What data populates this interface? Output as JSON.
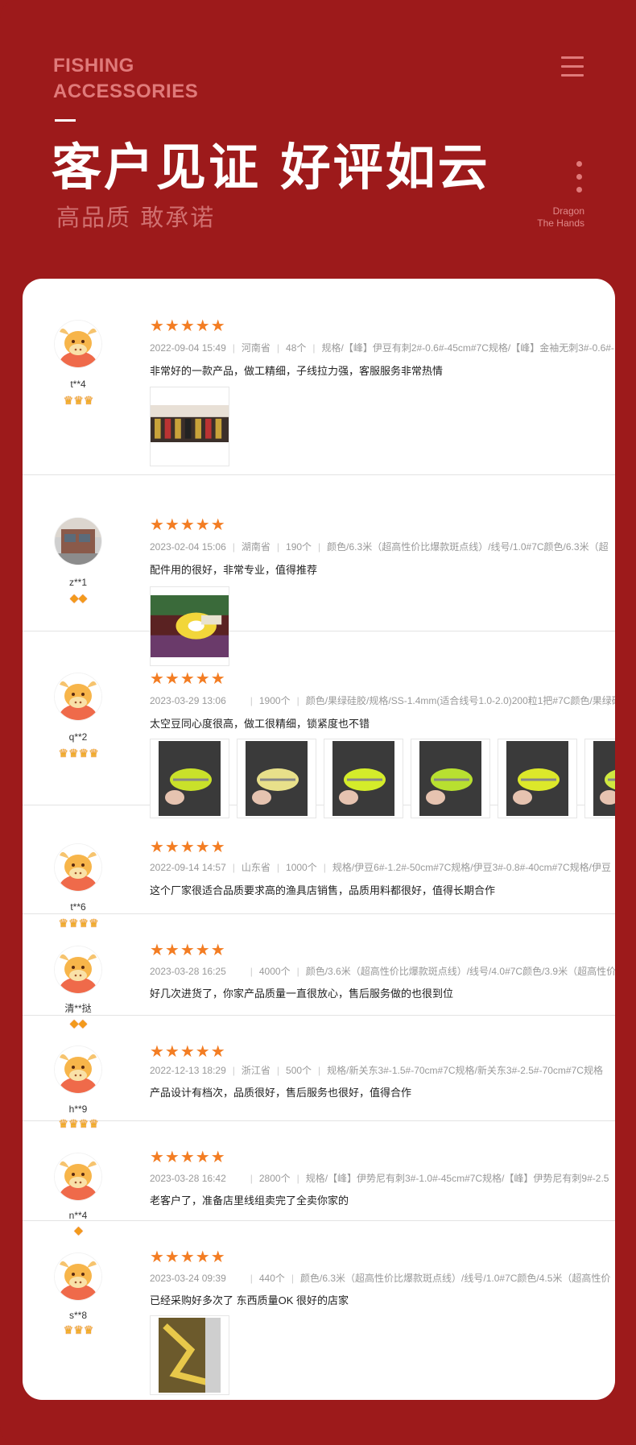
{
  "header": {
    "brand_line1": "FISHING",
    "brand_line2": "ACCESSORIES",
    "headline": "客户见证 好评如云",
    "subline": "高品质 敢承诺",
    "tagline_line1": "Dragon",
    "tagline_line2": "The Hands"
  },
  "colors": {
    "background": "#9d1a1b",
    "accent_star": "#f37d23",
    "card": "#ffffff"
  },
  "reviews": [
    {
      "user": "t**4",
      "badges": [
        "crown",
        "crown",
        "crown"
      ],
      "stars": "★★★★★",
      "date": "2022-09-04 15:49",
      "province": "河南省",
      "qty": "48个",
      "spec": "规格/【峰】伊豆有刺2#-0.6#-45cm#7C规格/【峰】金袖无刺3#-0.6#-",
      "comment": "非常好的一款产品，做工精细，子线拉力强，客服服务非常热情",
      "images": 1
    },
    {
      "user": "z**1",
      "badges": [
        "gem",
        "gem"
      ],
      "stars": "★★★★★",
      "date": "2023-02-04 15:06",
      "province": "湖南省",
      "qty": "190个",
      "spec": "颜色/6.3米（超高性价比爆款斑点线）/线号/1.0#7C颜色/6.3米（超",
      "comment": "配件用的很好，非常专业，值得推荐",
      "images": 1
    },
    {
      "user": "q**2",
      "badges": [
        "crown",
        "crown",
        "crown",
        "crown"
      ],
      "stars": "★★★★★",
      "date": "2023-03-29 13:06",
      "province": "",
      "qty": "1900个",
      "spec": "颜色/果绿硅胶/规格/SS-1.4mm(适合线号1.0-2.0)200粒1把#7C颜色/果绿硅",
      "comment": "太空豆同心度很高，做工很精细，锁紧度也不错",
      "images": 6
    },
    {
      "user": "t**6",
      "badges": [
        "crown",
        "crown",
        "crown",
        "crown"
      ],
      "stars": "★★★★★",
      "date": "2022-09-14 14:57",
      "province": "山东省",
      "qty": "1000个",
      "spec": "规格/伊豆6#-1.2#-50cm#7C规格/伊豆3#-0.8#-40cm#7C规格/伊豆",
      "comment": "这个厂家很适合品质要求高的渔具店销售，品质用料都很好，值得长期合作",
      "images": 0
    },
    {
      "user": "清**挞",
      "badges": [
        "gem",
        "gem"
      ],
      "stars": "★★★★★",
      "date": "2023-03-28 16:25",
      "province": "",
      "qty": "4000个",
      "spec": "颜色/3.6米（超高性价比爆款斑点线）/线号/4.0#7C颜色/3.9米（超高性价",
      "comment": "好几次进货了，你家产品质量一直很放心，售后服务做的也很到位",
      "images": 0
    },
    {
      "user": "h**9",
      "badges": [
        "crown",
        "crown",
        "crown",
        "crown"
      ],
      "stars": "★★★★★",
      "date": "2022-12-13 18:29",
      "province": "浙江省",
      "qty": "500个",
      "spec": "规格/新关东3#-1.5#-70cm#7C规格/新关东3#-2.5#-70cm#7C规格",
      "comment": "产品设计有档次，品质很好，售后服务也很好，值得合作",
      "images": 0
    },
    {
      "user": "n**4",
      "badges": [
        "gem"
      ],
      "stars": "★★★★★",
      "date": "2023-03-28 16:42",
      "province": "",
      "qty": "2800个",
      "spec": "规格/【峰】伊势尼有刺3#-1.0#-45cm#7C规格/【峰】伊势尼有刺9#-2.5",
      "comment": "老客户了，准备店里线组卖完了全卖你家的",
      "images": 0
    },
    {
      "user": "s**8",
      "badges": [
        "crown",
        "crown",
        "crown"
      ],
      "stars": "★★★★★",
      "date": "2023-03-24 09:39",
      "province": "",
      "qty": "440个",
      "spec": "颜色/6.3米（超高性价比爆款斑点线）/线号/1.0#7C颜色/4.5米（超高性价",
      "comment": "已经采购好多次了 东西质量OK 很好的店家",
      "images": 1
    }
  ]
}
